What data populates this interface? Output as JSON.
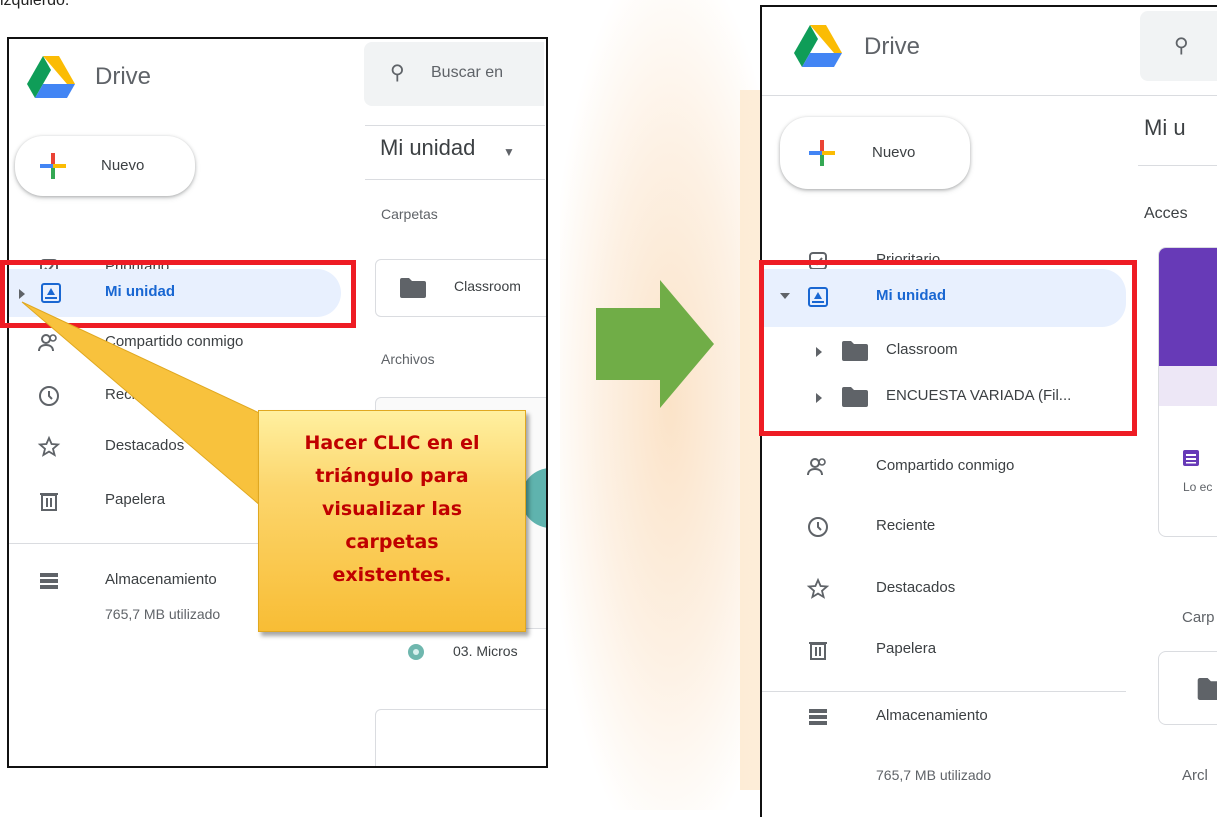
{
  "top_fragment": "izquierdo.",
  "left_panel": {
    "app_title": "Drive",
    "search_placeholder": "Buscar en",
    "new_button": "Nuevo",
    "nav": {
      "priority": "Prioritario",
      "my_drive": "Mi unidad",
      "shared": "Compartido conmigo",
      "recent": "Reciente",
      "starred": "Destacados",
      "trash": "Papelera",
      "storage": "Almacenamiento"
    },
    "storage_used": "765,7 MB utilizado",
    "main_title": "Mi unidad",
    "folders_label": "Carpetas",
    "folder_name": "Classroom",
    "files_label": "Archivos",
    "file_name": "03. Micros"
  },
  "callout": {
    "lines": [
      "Hacer CLIC en el",
      "triángulo para",
      "visualizar las",
      "carpetas",
      "existentes."
    ]
  },
  "right_panel": {
    "app_title": "Drive",
    "new_button": "Nuevo",
    "nav": {
      "priority": "Prioritario",
      "my_drive": "Mi unidad",
      "sub_folder_1": "Classroom",
      "sub_folder_2": "ENCUESTA VARIADA (Fil...",
      "shared": "Compartido conmigo",
      "recent": "Reciente",
      "starred": "Destacados",
      "trash": "Papelera",
      "storage": "Almacenamiento"
    },
    "storage_used": "765,7 MB utilizado",
    "main_title": "Mi u",
    "quick_access_label": "Acces",
    "card_text": "Lo ec",
    "folders_label": "Carp",
    "files_label": "Arcl"
  },
  "colors": {
    "highlight_red": "#ee1c24",
    "arrow_green": "#70ad47",
    "callout_text": "#c00000",
    "active_blue": "#1967d2",
    "purple_card": "#673ab7"
  }
}
